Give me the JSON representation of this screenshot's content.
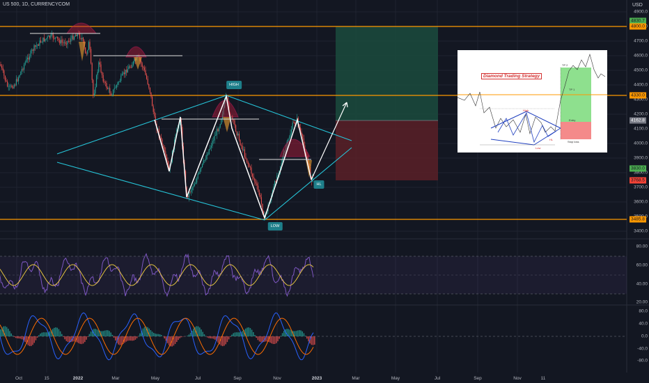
{
  "header": {
    "symbol_line": "US 500, 1D, CURRENCYCOM",
    "currency": "USD"
  },
  "price_axis": {
    "labels": [
      "4900.0",
      "4800.0",
      "4700.0",
      "4600.0",
      "4500.0",
      "4400.0",
      "4300.0",
      "4200.0",
      "4100.0",
      "4000.0",
      "3900.0",
      "3800.0",
      "3700.0",
      "3600.0",
      "3500.0",
      "3400.0"
    ]
  },
  "price_tags": [
    {
      "text": "4830.7",
      "color": "#4caf50"
    },
    {
      "text": "4800.0",
      "color": "#ff9800"
    },
    {
      "text": "4330.0",
      "color": "#ff9800"
    },
    {
      "text": "4162.8",
      "color": "#787b86"
    },
    {
      "text": "3830.0",
      "color": "#4caf50"
    },
    {
      "text": "3768.5",
      "color": "#f44336"
    },
    {
      "text": "3485.8",
      "color": "#ff9800"
    }
  ],
  "rsi_axis": {
    "labels": [
      "80.00",
      "60.00",
      "40.00",
      "20.00"
    ]
  },
  "macd_axis": {
    "labels": [
      "80.0",
      "40.0",
      "0.0",
      "-40.0",
      "-80.0"
    ]
  },
  "time_axis": {
    "labels": [
      {
        "text": "Oct",
        "bold": false
      },
      {
        "text": "15",
        "bold": false
      },
      {
        "text": "2022",
        "bold": true
      },
      {
        "text": "Mar",
        "bold": false
      },
      {
        "text": "May",
        "bold": false
      },
      {
        "text": "Jul",
        "bold": false
      },
      {
        "text": "Sep",
        "bold": false
      },
      {
        "text": "Nov",
        "bold": false
      },
      {
        "text": "2023",
        "bold": true
      },
      {
        "text": "Mar",
        "bold": false
      },
      {
        "text": "May",
        "bold": false
      },
      {
        "text": "Jul",
        "bold": false
      },
      {
        "text": "Sep",
        "bold": false
      },
      {
        "text": "Nov",
        "bold": false
      },
      {
        "text": "11",
        "bold": false
      }
    ]
  },
  "annotations": {
    "high": "HIGH",
    "low": "LOW",
    "hl": "HL"
  },
  "inset": {
    "title": "Diamond Trading Strategy",
    "high": "High",
    "low": "Low",
    "hl": "HL",
    "tp2": "TP 2",
    "tp1": "TP 1",
    "entry": "Entry",
    "stop": "Stop loss"
  },
  "colors": {
    "background": "#131722",
    "horizontal_level": "#ff9800",
    "diamond": "#26c6da",
    "profit_zone": "#1b4b3d",
    "loss_zone": "#5b2027",
    "rsi_line": "#7e57c2",
    "rsi_ma": "#f5d142",
    "macd_line": "#2962ff",
    "signal_line": "#ff6d00",
    "hist_up": "#26a69a",
    "hist_down": "#ef5350"
  }
}
